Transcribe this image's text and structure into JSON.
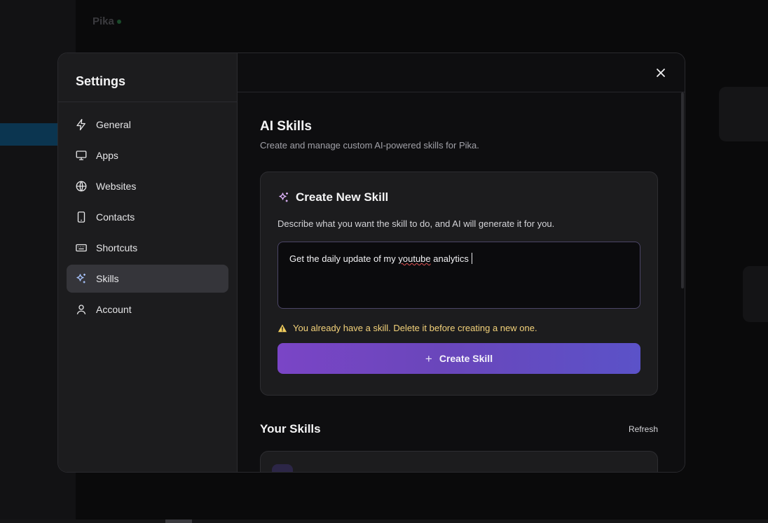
{
  "background": {
    "app_title": "Pika"
  },
  "settings": {
    "title": "Settings",
    "nav": [
      {
        "id": "general",
        "label": "General",
        "icon": "lightning-icon"
      },
      {
        "id": "apps",
        "label": "Apps",
        "icon": "monitor-icon"
      },
      {
        "id": "websites",
        "label": "Websites",
        "icon": "globe-icon"
      },
      {
        "id": "contacts",
        "label": "Contacts",
        "icon": "phone-icon"
      },
      {
        "id": "shortcuts",
        "label": "Shortcuts",
        "icon": "keyboard-icon"
      },
      {
        "id": "skills",
        "label": "Skills",
        "icon": "sparkles-icon",
        "active": true
      },
      {
        "id": "account",
        "label": "Account",
        "icon": "user-icon"
      }
    ]
  },
  "main": {
    "title": "AI Skills",
    "subtitle": "Create and manage custom AI-powered skills for Pika.",
    "create_card": {
      "title": "Create New Skill",
      "description": "Describe what you want the skill to do, and AI will generate it for you.",
      "input_value_before": "Get the daily update of my ",
      "input_value_misspelled": "youtube",
      "input_value_after": " analytics",
      "warning": "You already have a skill. Delete it before creating a new one.",
      "button_label": "Create Skill"
    },
    "your_skills": {
      "title": "Your Skills",
      "refresh_label": "Refresh"
    }
  },
  "colors": {
    "accent_start": "#7a45c6",
    "accent_end": "#5b52c8",
    "warning": "#f3d27a",
    "active_nav": "#35353a"
  }
}
